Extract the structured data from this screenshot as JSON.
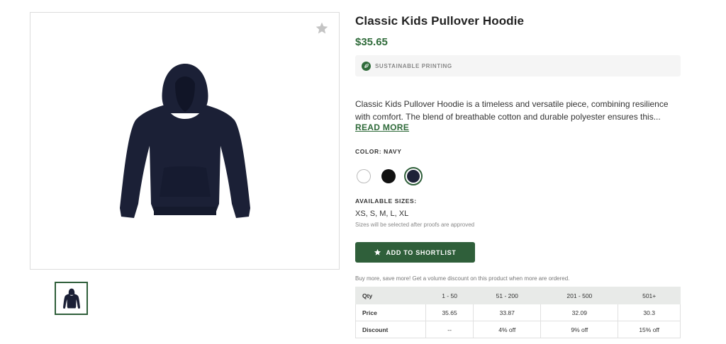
{
  "product": {
    "title": "Classic Kids Pullover Hoodie",
    "price": "$35.65",
    "badge": "SUSTAINABLE PRINTING",
    "description_line1": "Classic Kids Pullover Hoodie is a timeless and versatile piece, combining resilience",
    "description_line2": "with comfort. The blend of breathable cotton and durable polyester ensures this...",
    "read_more": "READ MORE",
    "color_label": "COLOR: NAVY",
    "colors": [
      {
        "name": "White",
        "hex": "#ffffff"
      },
      {
        "name": "Black",
        "hex": "#111111"
      },
      {
        "name": "Navy",
        "hex": "#1e2238",
        "selected": true
      }
    ],
    "sizes_label": "AVAILABLE SIZES:",
    "sizes_value": "XS, S, M, L, XL",
    "sizes_note": "Sizes will be selected after proofs are approved",
    "shortlist_label": "ADD TO SHORTLIST",
    "volume_note": "Buy more, save more! Get a volume discount on this product when more are ordered."
  },
  "pricing_table": {
    "headers": [
      "Qty",
      "1 - 50",
      "51 - 200",
      "201 - 500",
      "501+"
    ],
    "rows": [
      [
        "Price",
        "35.65",
        "33.87",
        "32.09",
        "30.3"
      ],
      [
        "Discount",
        "--",
        "4% off",
        "9% off",
        "15% off"
      ]
    ]
  },
  "icons": {
    "favorite": "star-icon",
    "badge": "leaf-icon",
    "button": "star-icon"
  },
  "colors": {
    "brand_green": "#2f6b3a",
    "button_green": "#2f5f3a",
    "garment_navy": "#1b2036"
  }
}
